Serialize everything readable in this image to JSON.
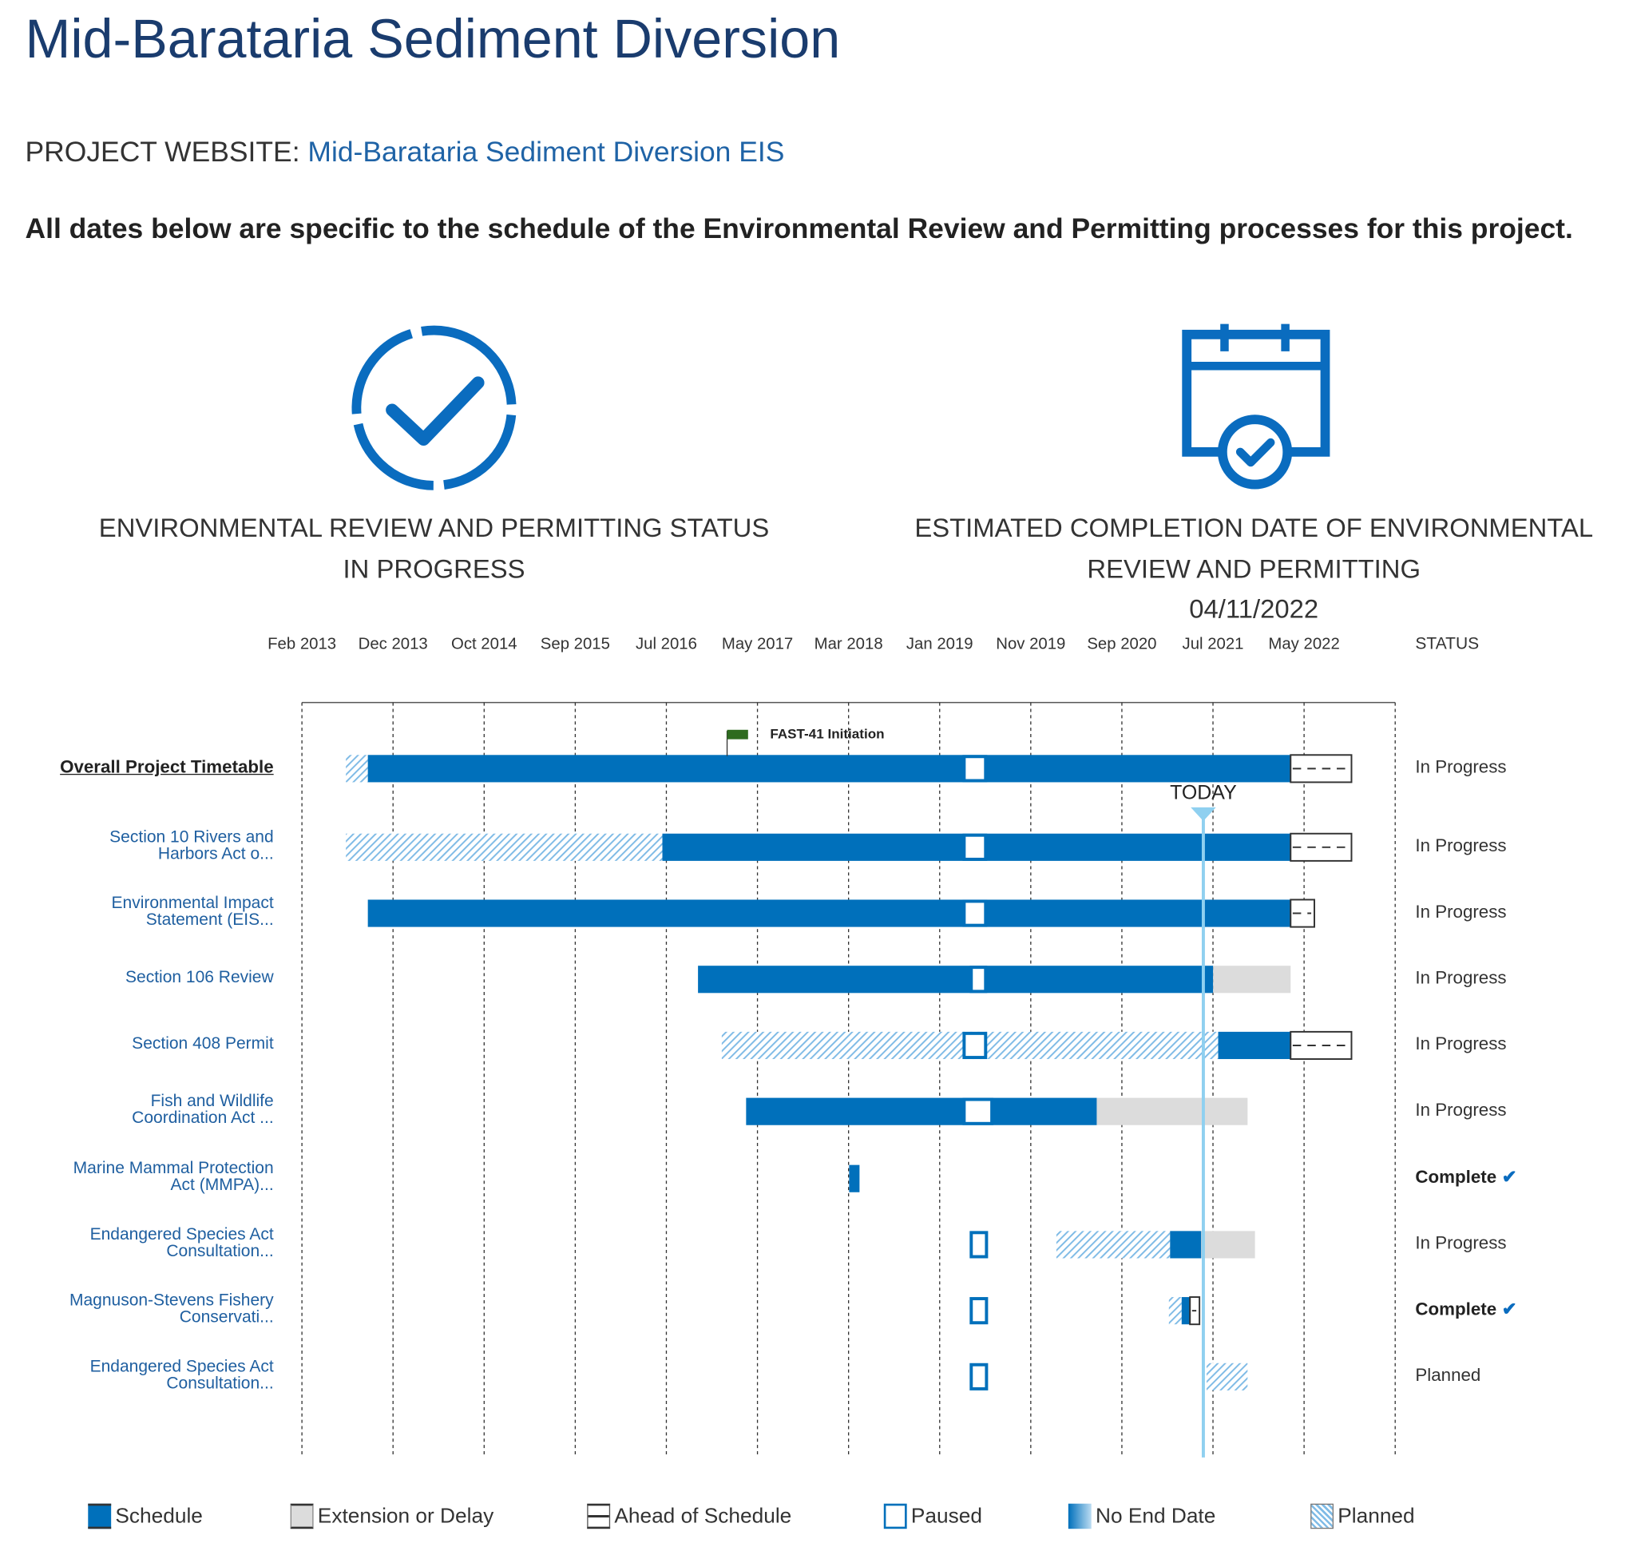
{
  "page": {
    "title": "Mid-Barataria Sediment Diversion",
    "website_label": "PROJECT WEBSITE:",
    "website_link": "Mid-Barataria Sediment Diversion EIS",
    "note": "All dates below are specific to the schedule of the Environmental Review and Permitting processes for this project."
  },
  "summary": {
    "status_heading": "ENVIRONMENTAL REVIEW AND PERMITTING STATUS",
    "status_value": "IN PROGRESS",
    "completion_heading_1": "ESTIMATED COMPLETION DATE OF ENVIRONMENTAL",
    "completion_heading_2": "REVIEW AND PERMITTING",
    "completion_date": "04/11/2022",
    "status_icon": "circle-check-icon",
    "completion_icon": "calendar-check-icon"
  },
  "colors": {
    "schedule": "#0070bb",
    "extension": "#dcdcdc",
    "planned": "#7fbbe6",
    "today": "#8fd0f0",
    "flag": "#2e6b1f",
    "title": "#1a3c6e",
    "link": "#1f63a6"
  },
  "chart_data": {
    "type": "gantt",
    "x_ticks": [
      "Feb 2013",
      "Dec 2013",
      "Oct 2014",
      "Sep 2015",
      "Jul 2016",
      "May 2017",
      "Mar 2018",
      "Jan 2019",
      "Nov 2019",
      "Sep 2020",
      "Jul 2021",
      "May 2022"
    ],
    "status_header": "STATUS",
    "today_label": "TODAY",
    "today": "2021-05-26",
    "milestone": {
      "label": "FAST-41 Initiation",
      "date": "2017-01-03"
    },
    "rows": [
      {
        "label": [
          "Overall Project Timetable"
        ],
        "main": true,
        "status": "In Progress",
        "complete": false,
        "segments": [
          {
            "type": "planned",
            "start": "2013-06-29",
            "end": "2013-09-11"
          },
          {
            "type": "schedule",
            "start": "2013-09-11",
            "end": "2022-03-16"
          },
          {
            "type": "ahead",
            "start": "2022-03-16",
            "end": "2022-10-07"
          },
          {
            "type": "paused",
            "start": "2019-03-07",
            "end": "2019-05-29"
          }
        ]
      },
      {
        "label": [
          "Section 10 Rivers and",
          "Harbors Act o..."
        ],
        "status": "In Progress",
        "complete": false,
        "segments": [
          {
            "type": "planned",
            "start": "2013-06-29",
            "end": "2016-05-30"
          },
          {
            "type": "schedule",
            "start": "2016-05-30",
            "end": "2022-03-16"
          },
          {
            "type": "ahead",
            "start": "2022-03-16",
            "end": "2022-10-07"
          },
          {
            "type": "paused",
            "start": "2019-03-07",
            "end": "2019-05-29"
          }
        ]
      },
      {
        "label": [
          "Environmental Impact",
          "Statement (EIS..."
        ],
        "status": "In Progress",
        "complete": false,
        "segments": [
          {
            "type": "schedule",
            "start": "2013-09-11",
            "end": "2022-03-16"
          },
          {
            "type": "ahead",
            "start": "2022-03-16",
            "end": "2022-06-04"
          },
          {
            "type": "paused",
            "start": "2019-03-07",
            "end": "2019-05-29"
          }
        ]
      },
      {
        "label": [
          "Section 106 Review"
        ],
        "status": "In Progress",
        "complete": false,
        "segments": [
          {
            "type": "schedule",
            "start": "2016-09-27",
            "end": "2021-06-28"
          },
          {
            "type": "extension",
            "start": "2021-06-28",
            "end": "2022-03-16"
          },
          {
            "type": "paused",
            "start": "2019-03-31",
            "end": "2019-05-29"
          }
        ]
      },
      {
        "label": [
          "Section 408 Permit"
        ],
        "status": "In Progress",
        "complete": false,
        "segments": [
          {
            "type": "planned",
            "start": "2016-12-16",
            "end": "2021-07-15"
          },
          {
            "type": "schedule",
            "start": "2021-07-15",
            "end": "2022-03-16"
          },
          {
            "type": "ahead",
            "start": "2022-03-16",
            "end": "2022-10-07"
          },
          {
            "type": "paused",
            "start": "2019-03-07",
            "end": "2019-05-29"
          }
        ]
      },
      {
        "label": [
          "Fish and Wildlife",
          "Coordination Act ..."
        ],
        "status": "In Progress",
        "complete": false,
        "segments": [
          {
            "type": "schedule",
            "start": "2017-03-08",
            "end": "2020-06-01"
          },
          {
            "type": "extension",
            "start": "2020-06-01",
            "end": "2021-10-22"
          },
          {
            "type": "paused",
            "start": "2019-03-07",
            "end": "2019-06-19"
          }
        ]
      },
      {
        "label": [
          "Marine Mammal Protection",
          "Act (MMPA)..."
        ],
        "status": "Complete",
        "complete": true,
        "segments": [
          {
            "type": "schedule",
            "start": "2018-02-18",
            "end": "2018-03-25"
          }
        ]
      },
      {
        "label": [
          "Endangered Species Act",
          "Consultation..."
        ],
        "status": "In Progress",
        "complete": false,
        "segments": [
          {
            "type": "paused",
            "start": "2019-03-31",
            "end": "2019-06-01"
          },
          {
            "type": "planned",
            "start": "2020-01-17",
            "end": "2021-02-03"
          },
          {
            "type": "schedule",
            "start": "2021-02-03",
            "end": "2021-05-19"
          },
          {
            "type": "extension",
            "start": "2021-05-19",
            "end": "2021-11-16"
          }
        ]
      },
      {
        "label": [
          "Magnuson-Stevens Fishery",
          "Conservati..."
        ],
        "status": "Complete",
        "complete": true,
        "segments": [
          {
            "type": "paused",
            "start": "2019-03-31",
            "end": "2019-06-01"
          },
          {
            "type": "planned",
            "start": "2021-01-30",
            "end": "2021-03-14"
          },
          {
            "type": "schedule",
            "start": "2021-03-14",
            "end": "2021-04-11"
          },
          {
            "type": "ahead",
            "start": "2021-04-11",
            "end": "2021-05-13"
          }
        ]
      },
      {
        "label": [
          "Endangered Species Act",
          "Consultation..."
        ],
        "status": "Planned",
        "complete": false,
        "segments": [
          {
            "type": "paused",
            "start": "2019-03-31",
            "end": "2019-06-01"
          },
          {
            "type": "planned",
            "start": "2021-06-06",
            "end": "2021-10-22"
          }
        ]
      }
    ],
    "legend": [
      {
        "key": "schedule",
        "label": "Schedule"
      },
      {
        "key": "extension",
        "label": "Extension or Delay"
      },
      {
        "key": "ahead",
        "label": "Ahead of Schedule"
      },
      {
        "key": "paused",
        "label": "Paused"
      },
      {
        "key": "noend",
        "label": "No End Date"
      },
      {
        "key": "planned",
        "label": "Planned"
      }
    ]
  }
}
